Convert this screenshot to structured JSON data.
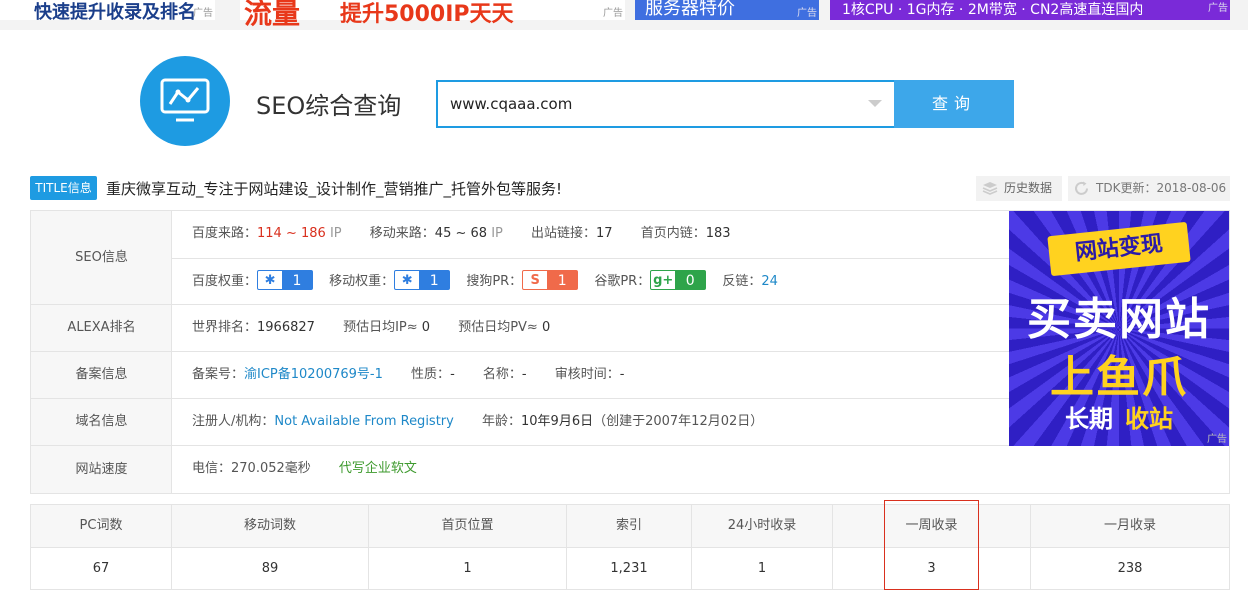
{
  "ads": {
    "ad1_text": "快速提升收录及排名",
    "ad2_big": "流量",
    "ad2_rest": "提升5000IP天天",
    "ad3_text": "服务器特价",
    "ad4_text": "1核CPU · 1G内存 · 2M带宽 · CN2高速直连国内",
    "tag": "广告"
  },
  "header": {
    "title": "SEO综合查询",
    "search_value": "www.cqaaa.com",
    "search_button": "查询"
  },
  "title_row": {
    "badge": "TITLE信息",
    "text": "重庆微享互动_专注于网站建设_设计制作_营销推广_托管外包等服务!",
    "history_button": "历史数据",
    "tdk_label": "TDK更新：",
    "tdk_date": "2018-08-06"
  },
  "seo": {
    "label": "SEO信息",
    "baidu_source_label": "百度来路：",
    "baidu_source_value": "114 ~ 186",
    "ip_unit": "IP",
    "mobile_source_label": "移动来路：",
    "mobile_source_value": "45 ~ 68",
    "outlinks_label": "出站链接：",
    "outlinks_value": "17",
    "inlinks_label": "首页内链：",
    "inlinks_value": "183",
    "baidu_weight_label": "百度权重：",
    "baidu_weight_value": "1",
    "mobile_weight_label": "移动权重：",
    "mobile_weight_value": "1",
    "sogou_label": "搜狗PR：",
    "sogou_value": "1",
    "google_label": "谷歌PR：",
    "google_value": "0",
    "backlinks_label": "反链：",
    "backlinks_value": "24"
  },
  "alexa": {
    "label": "ALEXA排名",
    "world_rank_label": "世界排名：",
    "world_rank_value": "1966827",
    "daily_ip_label": "预估日均IP≈",
    "daily_ip_value": "0",
    "daily_pv_label": "预估日均PV≈",
    "daily_pv_value": "0"
  },
  "icp": {
    "label": "备案信息",
    "number_label": "备案号：",
    "number_value": "渝ICP备10200769号-1",
    "nature_label": "性质：",
    "nature_value": "-",
    "name_label": "名称：",
    "name_value": "-",
    "review_label": "审核时间：",
    "review_value": "-"
  },
  "domain": {
    "label": "域名信息",
    "registrant_label": "注册人/机构：",
    "registrant_value": "Not Available From Registry",
    "age_label": "年龄：",
    "age_value": "10年9月6日",
    "created_text": "（创建于2007年12月02日）"
  },
  "speed": {
    "label": "网站速度",
    "telecom_label": "电信：",
    "telecom_value": "270.052毫秒",
    "link_text": "代写企业软文"
  },
  "side_ad": {
    "line1": "网站变现",
    "line2": "买卖网站",
    "line3": "上鱼爪",
    "line4a": "长期",
    "line4b": "收站"
  },
  "stats": {
    "headers": [
      "PC词数",
      "移动词数",
      "首页位置",
      "索引",
      "24小时收录",
      "一周收录",
      "一月收录"
    ],
    "values": [
      "67",
      "89",
      "1",
      "1,231",
      "1",
      "3",
      "238"
    ]
  },
  "colors": {
    "accent": "#1e9be2",
    "button": "#3da7ea",
    "red": "#d9301e",
    "link": "#1e88c8",
    "green": "#3e9a2e"
  }
}
